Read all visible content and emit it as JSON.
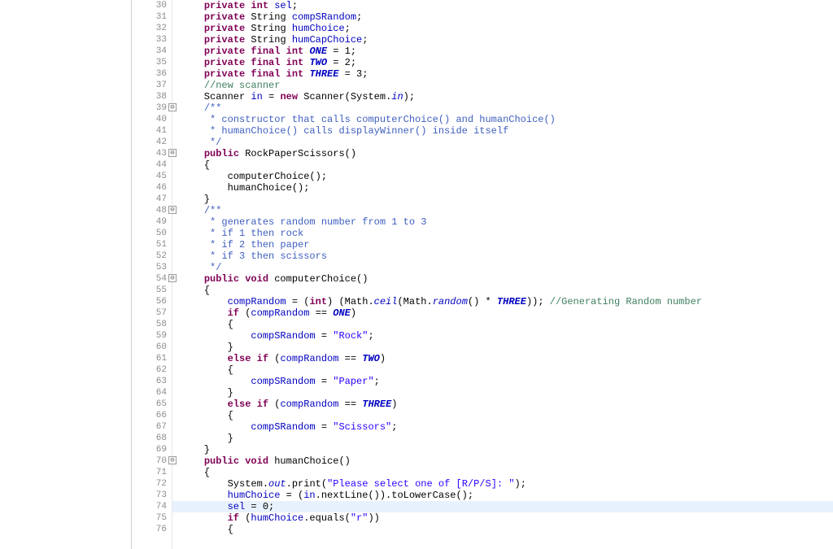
{
  "lines": [
    {
      "num": 30,
      "fold": null,
      "tokens": [
        {
          "t": "    ",
          "c": ""
        },
        {
          "t": "private int",
          "c": "kw"
        },
        {
          "t": " ",
          "c": ""
        },
        {
          "t": "sel",
          "c": "field"
        },
        {
          "t": ";",
          "c": ""
        }
      ]
    },
    {
      "num": 31,
      "fold": null,
      "tokens": [
        {
          "t": "    ",
          "c": ""
        },
        {
          "t": "private",
          "c": "kw"
        },
        {
          "t": " String ",
          "c": ""
        },
        {
          "t": "compSRandom",
          "c": "field"
        },
        {
          "t": ";",
          "c": ""
        }
      ]
    },
    {
      "num": 32,
      "fold": null,
      "tokens": [
        {
          "t": "    ",
          "c": ""
        },
        {
          "t": "private",
          "c": "kw"
        },
        {
          "t": " String ",
          "c": ""
        },
        {
          "t": "humChoice",
          "c": "field"
        },
        {
          "t": ";",
          "c": ""
        }
      ]
    },
    {
      "num": 33,
      "fold": null,
      "tokens": [
        {
          "t": "    ",
          "c": ""
        },
        {
          "t": "private",
          "c": "kw"
        },
        {
          "t": " String ",
          "c": ""
        },
        {
          "t": "humCapChoice",
          "c": "field"
        },
        {
          "t": ";",
          "c": ""
        }
      ]
    },
    {
      "num": 34,
      "fold": null,
      "tokens": [
        {
          "t": "    ",
          "c": ""
        },
        {
          "t": "private final int",
          "c": "kw"
        },
        {
          "t": " ",
          "c": ""
        },
        {
          "t": "ONE",
          "c": "constfinal"
        },
        {
          "t": " = 1;",
          "c": ""
        }
      ]
    },
    {
      "num": 35,
      "fold": null,
      "tokens": [
        {
          "t": "    ",
          "c": ""
        },
        {
          "t": "private final int",
          "c": "kw"
        },
        {
          "t": " ",
          "c": ""
        },
        {
          "t": "TWO",
          "c": "constfinal"
        },
        {
          "t": " = 2;",
          "c": ""
        }
      ]
    },
    {
      "num": 36,
      "fold": null,
      "tokens": [
        {
          "t": "    ",
          "c": ""
        },
        {
          "t": "private final int",
          "c": "kw"
        },
        {
          "t": " ",
          "c": ""
        },
        {
          "t": "THREE",
          "c": "constfinal"
        },
        {
          "t": " = 3;",
          "c": ""
        }
      ]
    },
    {
      "num": 37,
      "fold": null,
      "tokens": [
        {
          "t": "    ",
          "c": ""
        },
        {
          "t": "//new scanner",
          "c": "comment"
        }
      ]
    },
    {
      "num": 38,
      "fold": null,
      "tokens": [
        {
          "t": "    Scanner ",
          "c": ""
        },
        {
          "t": "in",
          "c": "field"
        },
        {
          "t": " = ",
          "c": ""
        },
        {
          "t": "new",
          "c": "kw"
        },
        {
          "t": " Scanner(System.",
          "c": ""
        },
        {
          "t": "in",
          "c": "static-field"
        },
        {
          "t": ");",
          "c": ""
        }
      ]
    },
    {
      "num": 39,
      "fold": "collapse",
      "tokens": [
        {
          "t": "    ",
          "c": ""
        },
        {
          "t": "/**",
          "c": "javadoc"
        }
      ]
    },
    {
      "num": 40,
      "fold": null,
      "tokens": [
        {
          "t": "    ",
          "c": ""
        },
        {
          "t": " * constructor that calls computerChoice() and humanChoice()",
          "c": "javadoc"
        }
      ]
    },
    {
      "num": 41,
      "fold": null,
      "tokens": [
        {
          "t": "    ",
          "c": ""
        },
        {
          "t": " * humanChoice() calls displayWinner() inside itself",
          "c": "javadoc"
        }
      ]
    },
    {
      "num": 42,
      "fold": null,
      "tokens": [
        {
          "t": "    ",
          "c": ""
        },
        {
          "t": " */",
          "c": "javadoc"
        }
      ]
    },
    {
      "num": 43,
      "fold": "collapse",
      "tokens": [
        {
          "t": "    ",
          "c": ""
        },
        {
          "t": "public",
          "c": "kw"
        },
        {
          "t": " RockPaperScissors()",
          "c": ""
        }
      ]
    },
    {
      "num": 44,
      "fold": null,
      "tokens": [
        {
          "t": "    {",
          "c": ""
        }
      ]
    },
    {
      "num": 45,
      "fold": null,
      "tokens": [
        {
          "t": "        computerChoice();",
          "c": ""
        }
      ]
    },
    {
      "num": 46,
      "fold": null,
      "tokens": [
        {
          "t": "        humanChoice();",
          "c": ""
        }
      ]
    },
    {
      "num": 47,
      "fold": null,
      "tokens": [
        {
          "t": "    }",
          "c": ""
        }
      ]
    },
    {
      "num": 48,
      "fold": "collapse",
      "tokens": [
        {
          "t": "    ",
          "c": ""
        },
        {
          "t": "/**",
          "c": "javadoc"
        }
      ]
    },
    {
      "num": 49,
      "fold": null,
      "tokens": [
        {
          "t": "    ",
          "c": ""
        },
        {
          "t": " * generates random number from 1 to 3",
          "c": "javadoc"
        }
      ]
    },
    {
      "num": 50,
      "fold": null,
      "tokens": [
        {
          "t": "    ",
          "c": ""
        },
        {
          "t": " * if 1 then rock",
          "c": "javadoc"
        }
      ]
    },
    {
      "num": 51,
      "fold": null,
      "tokens": [
        {
          "t": "    ",
          "c": ""
        },
        {
          "t": " * if 2 then paper",
          "c": "javadoc"
        }
      ]
    },
    {
      "num": 52,
      "fold": null,
      "tokens": [
        {
          "t": "    ",
          "c": ""
        },
        {
          "t": " * if 3 then scissors",
          "c": "javadoc"
        }
      ]
    },
    {
      "num": 53,
      "fold": null,
      "tokens": [
        {
          "t": "    ",
          "c": ""
        },
        {
          "t": " */",
          "c": "javadoc"
        }
      ]
    },
    {
      "num": 54,
      "fold": "collapse",
      "tokens": [
        {
          "t": "    ",
          "c": ""
        },
        {
          "t": "public void",
          "c": "kw"
        },
        {
          "t": " computerChoice()",
          "c": ""
        }
      ]
    },
    {
      "num": 55,
      "fold": null,
      "tokens": [
        {
          "t": "    {",
          "c": ""
        }
      ]
    },
    {
      "num": 56,
      "fold": null,
      "tokens": [
        {
          "t": "        ",
          "c": ""
        },
        {
          "t": "compRandom",
          "c": "field"
        },
        {
          "t": " = (",
          "c": ""
        },
        {
          "t": "int",
          "c": "kw"
        },
        {
          "t": ") (Math.",
          "c": ""
        },
        {
          "t": "ceil",
          "c": "static-field"
        },
        {
          "t": "(Math.",
          "c": ""
        },
        {
          "t": "random",
          "c": "static-field"
        },
        {
          "t": "() * ",
          "c": ""
        },
        {
          "t": "THREE",
          "c": "constfinal"
        },
        {
          "t": ")); ",
          "c": ""
        },
        {
          "t": "//Generating Random number",
          "c": "comment"
        }
      ]
    },
    {
      "num": 57,
      "fold": null,
      "tokens": [
        {
          "t": "        ",
          "c": ""
        },
        {
          "t": "if",
          "c": "kw"
        },
        {
          "t": " (",
          "c": ""
        },
        {
          "t": "compRandom",
          "c": "field"
        },
        {
          "t": " == ",
          "c": ""
        },
        {
          "t": "ONE",
          "c": "constfinal"
        },
        {
          "t": ")",
          "c": ""
        }
      ]
    },
    {
      "num": 58,
      "fold": null,
      "tokens": [
        {
          "t": "        {",
          "c": ""
        }
      ]
    },
    {
      "num": 59,
      "fold": null,
      "tokens": [
        {
          "t": "            ",
          "c": ""
        },
        {
          "t": "compSRandom",
          "c": "field"
        },
        {
          "t": " = ",
          "c": ""
        },
        {
          "t": "\"Rock\"",
          "c": "str"
        },
        {
          "t": ";",
          "c": ""
        }
      ]
    },
    {
      "num": 60,
      "fold": null,
      "tokens": [
        {
          "t": "        }",
          "c": ""
        }
      ]
    },
    {
      "num": 61,
      "fold": null,
      "tokens": [
        {
          "t": "        ",
          "c": ""
        },
        {
          "t": "else if",
          "c": "kw"
        },
        {
          "t": " (",
          "c": ""
        },
        {
          "t": "compRandom",
          "c": "field"
        },
        {
          "t": " == ",
          "c": ""
        },
        {
          "t": "TWO",
          "c": "constfinal"
        },
        {
          "t": ")",
          "c": ""
        }
      ]
    },
    {
      "num": 62,
      "fold": null,
      "tokens": [
        {
          "t": "        {",
          "c": ""
        }
      ]
    },
    {
      "num": 63,
      "fold": null,
      "tokens": [
        {
          "t": "            ",
          "c": ""
        },
        {
          "t": "compSRandom",
          "c": "field"
        },
        {
          "t": " = ",
          "c": ""
        },
        {
          "t": "\"Paper\"",
          "c": "str"
        },
        {
          "t": ";",
          "c": ""
        }
      ]
    },
    {
      "num": 64,
      "fold": null,
      "tokens": [
        {
          "t": "        }",
          "c": ""
        }
      ]
    },
    {
      "num": 65,
      "fold": null,
      "tokens": [
        {
          "t": "        ",
          "c": ""
        },
        {
          "t": "else if",
          "c": "kw"
        },
        {
          "t": " (",
          "c": ""
        },
        {
          "t": "compRandom",
          "c": "field"
        },
        {
          "t": " == ",
          "c": ""
        },
        {
          "t": "THREE",
          "c": "constfinal"
        },
        {
          "t": ")",
          "c": ""
        }
      ]
    },
    {
      "num": 66,
      "fold": null,
      "tokens": [
        {
          "t": "        {",
          "c": ""
        }
      ]
    },
    {
      "num": 67,
      "fold": null,
      "tokens": [
        {
          "t": "            ",
          "c": ""
        },
        {
          "t": "compSRandom",
          "c": "field"
        },
        {
          "t": " = ",
          "c": ""
        },
        {
          "t": "\"Scissors\"",
          "c": "str"
        },
        {
          "t": ";",
          "c": ""
        }
      ]
    },
    {
      "num": 68,
      "fold": null,
      "tokens": [
        {
          "t": "        }",
          "c": ""
        }
      ]
    },
    {
      "num": 69,
      "fold": null,
      "tokens": [
        {
          "t": "    }",
          "c": ""
        }
      ]
    },
    {
      "num": 70,
      "fold": "collapse",
      "tokens": [
        {
          "t": "    ",
          "c": ""
        },
        {
          "t": "public void",
          "c": "kw"
        },
        {
          "t": " humanChoice()",
          "c": ""
        }
      ]
    },
    {
      "num": 71,
      "fold": null,
      "tokens": [
        {
          "t": "    {",
          "c": ""
        }
      ]
    },
    {
      "num": 72,
      "fold": null,
      "tokens": [
        {
          "t": "        System.",
          "c": ""
        },
        {
          "t": "out",
          "c": "static-field"
        },
        {
          "t": ".print(",
          "c": ""
        },
        {
          "t": "\"Please select one of [R/P/S]: \"",
          "c": "str"
        },
        {
          "t": ");",
          "c": ""
        }
      ]
    },
    {
      "num": 73,
      "fold": null,
      "tokens": [
        {
          "t": "        ",
          "c": ""
        },
        {
          "t": "humChoice",
          "c": "field"
        },
        {
          "t": " = (",
          "c": ""
        },
        {
          "t": "in",
          "c": "field"
        },
        {
          "t": ".nextLine()).toLowerCase();",
          "c": ""
        }
      ]
    },
    {
      "num": 74,
      "fold": null,
      "highlighted": true,
      "tokens": [
        {
          "t": "        ",
          "c": ""
        },
        {
          "t": "sel",
          "c": "field"
        },
        {
          "t": " = 0;",
          "c": ""
        }
      ]
    },
    {
      "num": 75,
      "fold": null,
      "tokens": [
        {
          "t": "        ",
          "c": ""
        },
        {
          "t": "if",
          "c": "kw"
        },
        {
          "t": " (",
          "c": ""
        },
        {
          "t": "humChoice",
          "c": "field"
        },
        {
          "t": ".equals(",
          "c": ""
        },
        {
          "t": "\"r\"",
          "c": "str"
        },
        {
          "t": "))",
          "c": ""
        }
      ]
    },
    {
      "num": 76,
      "fold": null,
      "tokens": [
        {
          "t": "        {",
          "c": ""
        }
      ]
    }
  ],
  "fold_glyph": "⊖"
}
